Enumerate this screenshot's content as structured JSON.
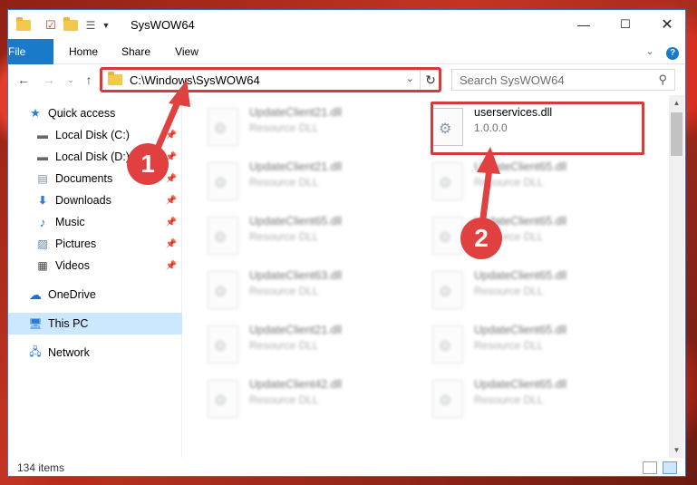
{
  "window": {
    "title": "SysWOW64"
  },
  "ribbon": {
    "tabs": [
      "File",
      "Home",
      "Share",
      "View"
    ]
  },
  "address": {
    "path": "C:\\Windows\\SysWOW64"
  },
  "search": {
    "placeholder": "Search SysWOW64"
  },
  "sidebar": {
    "items": [
      {
        "label": "Quick access",
        "icon": "star-icon"
      },
      {
        "label": "Local Disk (C:)",
        "icon": "drive-icon",
        "pinned": true
      },
      {
        "label": "Local Disk (D:)",
        "icon": "drive-icon",
        "pinned": true
      },
      {
        "label": "Documents",
        "icon": "documents-icon",
        "pinned": true
      },
      {
        "label": "Downloads",
        "icon": "download-icon",
        "pinned": true
      },
      {
        "label": "Music",
        "icon": "music-icon",
        "pinned": true
      },
      {
        "label": "Pictures",
        "icon": "pictures-icon",
        "pinned": true
      },
      {
        "label": "Videos",
        "icon": "videos-icon",
        "pinned": true
      },
      {
        "label": "OneDrive",
        "icon": "cloud-icon"
      },
      {
        "label": "This PC",
        "icon": "computer-icon",
        "selected": true
      },
      {
        "label": "Network",
        "icon": "network-icon"
      }
    ]
  },
  "files": {
    "highlighted": {
      "name": "userservices.dll",
      "sub": "1.0.0.0"
    },
    "left_column": [
      {
        "name": "UpdateClient21.dll",
        "sub": "Resource DLL"
      },
      {
        "name": "UpdateClient21.dll",
        "sub": "Resource DLL"
      },
      {
        "name": "UpdateClient65.dll",
        "sub": "Resource DLL"
      },
      {
        "name": "UpdateClient63.dll",
        "sub": "Resource DLL"
      },
      {
        "name": "UpdateClient21.dll",
        "sub": "Resource DLL"
      },
      {
        "name": "UpdateClient42.dll",
        "sub": "Resource DLL"
      }
    ],
    "right_column": [
      {
        "name": "UpdateClient65.dll",
        "sub": "Resource DLL"
      },
      {
        "name": "UpdateClient65.dll",
        "sub": "Resource DLL"
      },
      {
        "name": "UpdateClient65.dll",
        "sub": "Resource DLL"
      },
      {
        "name": "UpdateClient65.dll",
        "sub": "Resource DLL"
      },
      {
        "name": "UpdateClient65.dll",
        "sub": "Resource DLL"
      }
    ]
  },
  "status": {
    "item_count": "134 items"
  },
  "annotations": {
    "step1": "1",
    "step2": "2",
    "color": "#e04040"
  },
  "colors": {
    "accent": "#1979ca",
    "selection": "#cce8ff",
    "highlight_border": "#d63a3a"
  }
}
